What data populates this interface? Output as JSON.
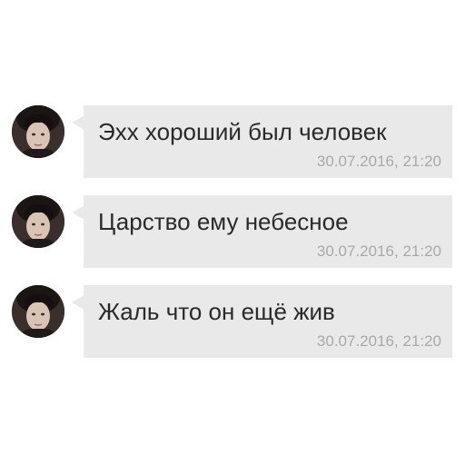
{
  "messages": [
    {
      "text": "Эхх хороший был человек",
      "time": "30.07.2016, 21:20",
      "avatar_icon": "user-avatar-photo"
    },
    {
      "text": "Царство ему небесное",
      "time": "30.07.2016, 21:20",
      "avatar_icon": "user-avatar-photo"
    },
    {
      "text": "Жаль что он ещё жив",
      "time": "30.07.2016, 21:20",
      "avatar_icon": "user-avatar-photo"
    }
  ],
  "colors": {
    "bubble": "#e9e9ea",
    "text": "#2a2a2a",
    "timestamp": "#a9a9ab",
    "background": "#ffffff"
  }
}
